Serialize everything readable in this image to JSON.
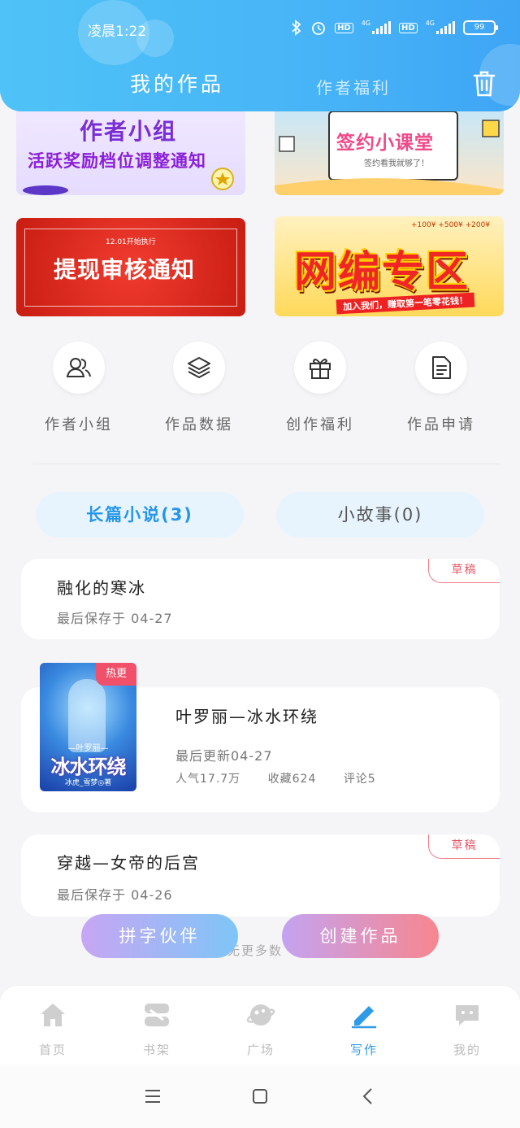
{
  "status_bar": {
    "time": "凌晨1:22",
    "hd1": "HD",
    "net1": "4G",
    "hd2": "HD",
    "net2": "4G",
    "battery": "99"
  },
  "header": {
    "tab_active": "我的作品",
    "tab_inactive": "作者福利"
  },
  "banners": [
    {
      "line1": "作者小组",
      "line2": "活跃奖励档位调整通知"
    },
    {
      "line1": "签约小课堂",
      "line2": "签约看我就够了！"
    },
    {
      "sub": "12.01开始执行",
      "line1": "提现审核通知"
    },
    {
      "nums": "+100¥ +500¥ +200¥",
      "line1": "网编专区",
      "strip": "加入我们，赚取第一笔零花钱！"
    }
  ],
  "entries": [
    {
      "label": "作者小组",
      "icon": "users-icon"
    },
    {
      "label": "作品数据",
      "icon": "layers-icon"
    },
    {
      "label": "创作福利",
      "icon": "gift-icon"
    },
    {
      "label": "作品申请",
      "icon": "document-icon"
    }
  ],
  "segments": {
    "novel": "长篇小说(3)",
    "story": "小故事(0)"
  },
  "works": [
    {
      "title": "融化的寒冰",
      "meta": "最后保存于 04-27",
      "tag": "草稿"
    },
    {
      "title": "叶罗丽—冰水环绕",
      "updated": "最后更新04-27",
      "popularity": "人气17.7万",
      "favorites": "收藏624",
      "comments": "评论5",
      "cover_tag": "热更",
      "cover_sub": "—叶罗丽—",
      "cover_title": "冰水环绕",
      "cover_author": "冰虎_雪梦◎著"
    },
    {
      "title": "穿越—女帝的后宫",
      "meta": "最后保存于 04-26",
      "tag": "草稿"
    }
  ],
  "no_more": "无更多数",
  "buttons": {
    "partner": "拼字伙伴",
    "create": "创建作品"
  },
  "bottom_nav": [
    {
      "label": "首页",
      "icon": "home-icon"
    },
    {
      "label": "书架",
      "icon": "bookshelf-icon"
    },
    {
      "label": "广场",
      "icon": "planet-icon"
    },
    {
      "label": "写作",
      "icon": "pen-icon"
    },
    {
      "label": "我的",
      "icon": "chat-bubble-icon"
    }
  ],
  "colors": {
    "header": "#47b4f7",
    "accent": "#2e9be8",
    "draft": "#e45a68"
  }
}
